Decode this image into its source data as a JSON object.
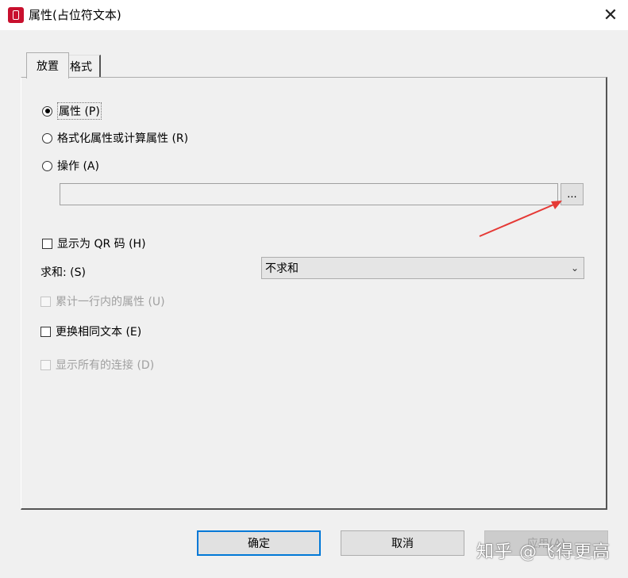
{
  "window": {
    "title": "属性(占位符文本)",
    "close_glyph": "✕"
  },
  "tabs": [
    {
      "label": "放置",
      "active": true
    },
    {
      "label": "格式",
      "active": false
    }
  ],
  "radios": [
    {
      "label": "属性 (P)",
      "checked": true
    },
    {
      "label": "格式化属性或计算属性 (R)",
      "checked": false
    },
    {
      "label": "操作 (A)",
      "checked": false
    }
  ],
  "action_input": {
    "value": ""
  },
  "browse_button": {
    "label": "..."
  },
  "checkboxes": {
    "qr": {
      "label": "显示为 QR 码 (H)",
      "checked": false,
      "enabled": true
    },
    "accumulate": {
      "label": "累计一行内的属性 (U)",
      "checked": false,
      "enabled": false
    },
    "replace": {
      "label": "更换相同文本 (E)",
      "checked": false,
      "enabled": true
    },
    "show_links": {
      "label": "显示所有的连接 (D)",
      "checked": false,
      "enabled": false
    }
  },
  "sum": {
    "label": "求和: (S)",
    "selected": "不求和"
  },
  "buttons": {
    "ok": "确定",
    "cancel": "取消",
    "apply": "应用(A)"
  },
  "watermark": "知乎 @飞得更高",
  "colors": {
    "accent": "#0078d7",
    "annotation_arrow": "#e53935",
    "app_icon": "#c8102e"
  },
  "icons": {
    "app": "app-icon",
    "close": "close-icon",
    "dropdown": "chevron-down-icon"
  }
}
